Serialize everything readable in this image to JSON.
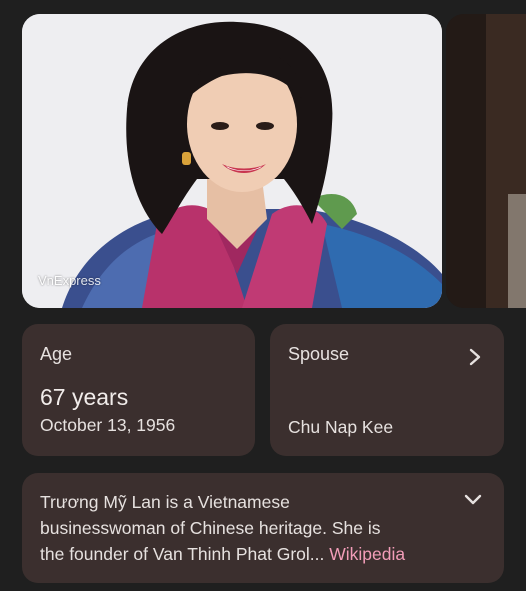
{
  "carousel": {
    "watermark": "VnExpress"
  },
  "age_card": {
    "label": "Age",
    "value": "67 years",
    "birth_date": "October 13, 1956"
  },
  "spouse_card": {
    "label": "Spouse",
    "value": "Chu Nap Kee"
  },
  "description": {
    "line1": "Trương Mỹ Lan is a Vietnamese",
    "line2": "businesswoman of Chinese heritage. She is",
    "line3": "the founder of Van Thinh Phat Gro",
    "truncation": "l... ",
    "link": "Wikipedia"
  },
  "colors": {
    "background": "#1f1f1f",
    "card": "#3b2f2e",
    "link": "#f29db8"
  },
  "icons": {
    "spouse_chevron": "chevron-right-icon",
    "expand_chevron": "chevron-down-icon"
  }
}
